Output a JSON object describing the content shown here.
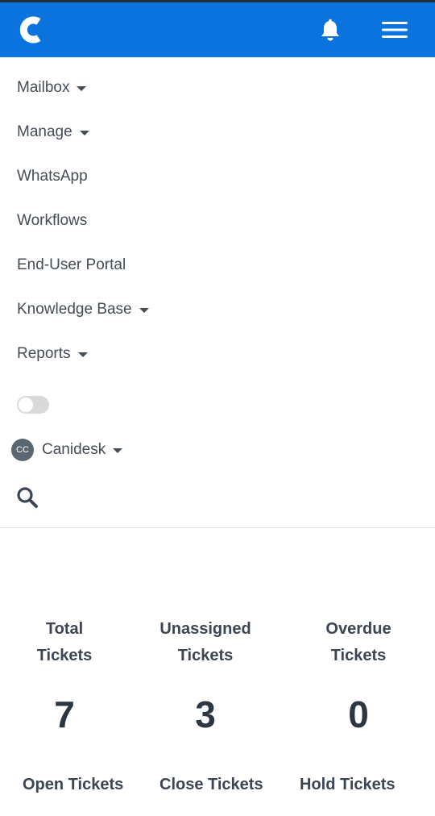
{
  "header": {
    "logo_icon": "canidesk-c-logo-icon",
    "bell_icon": "bell-icon",
    "menu_icon": "hamburger-menu-icon",
    "brand_color": "#0a73de"
  },
  "nav": {
    "items": [
      {
        "label": "Mailbox",
        "has_caret": true
      },
      {
        "label": "Manage",
        "has_caret": true
      },
      {
        "label": "WhatsApp",
        "has_caret": false
      },
      {
        "label": "Workflows",
        "has_caret": false
      },
      {
        "label": "End-User Portal",
        "has_caret": false
      },
      {
        "label": "Knowledge Base",
        "has_caret": true
      },
      {
        "label": "Reports",
        "has_caret": true
      }
    ]
  },
  "account": {
    "avatar_initials": "CC",
    "name": "Canidesk"
  },
  "stats": [
    {
      "label_line1": "Total",
      "label_line2": "Tickets",
      "value": "7"
    },
    {
      "label_line1": "Unassigned",
      "label_line2": "Tickets",
      "value": "3"
    },
    {
      "label_line1": "Overdue",
      "label_line2": "Tickets",
      "value": "0"
    }
  ],
  "bottom_stats": [
    {
      "label": "Open Tickets"
    },
    {
      "label": "Close Tickets"
    },
    {
      "label": "Hold Tickets"
    }
  ]
}
